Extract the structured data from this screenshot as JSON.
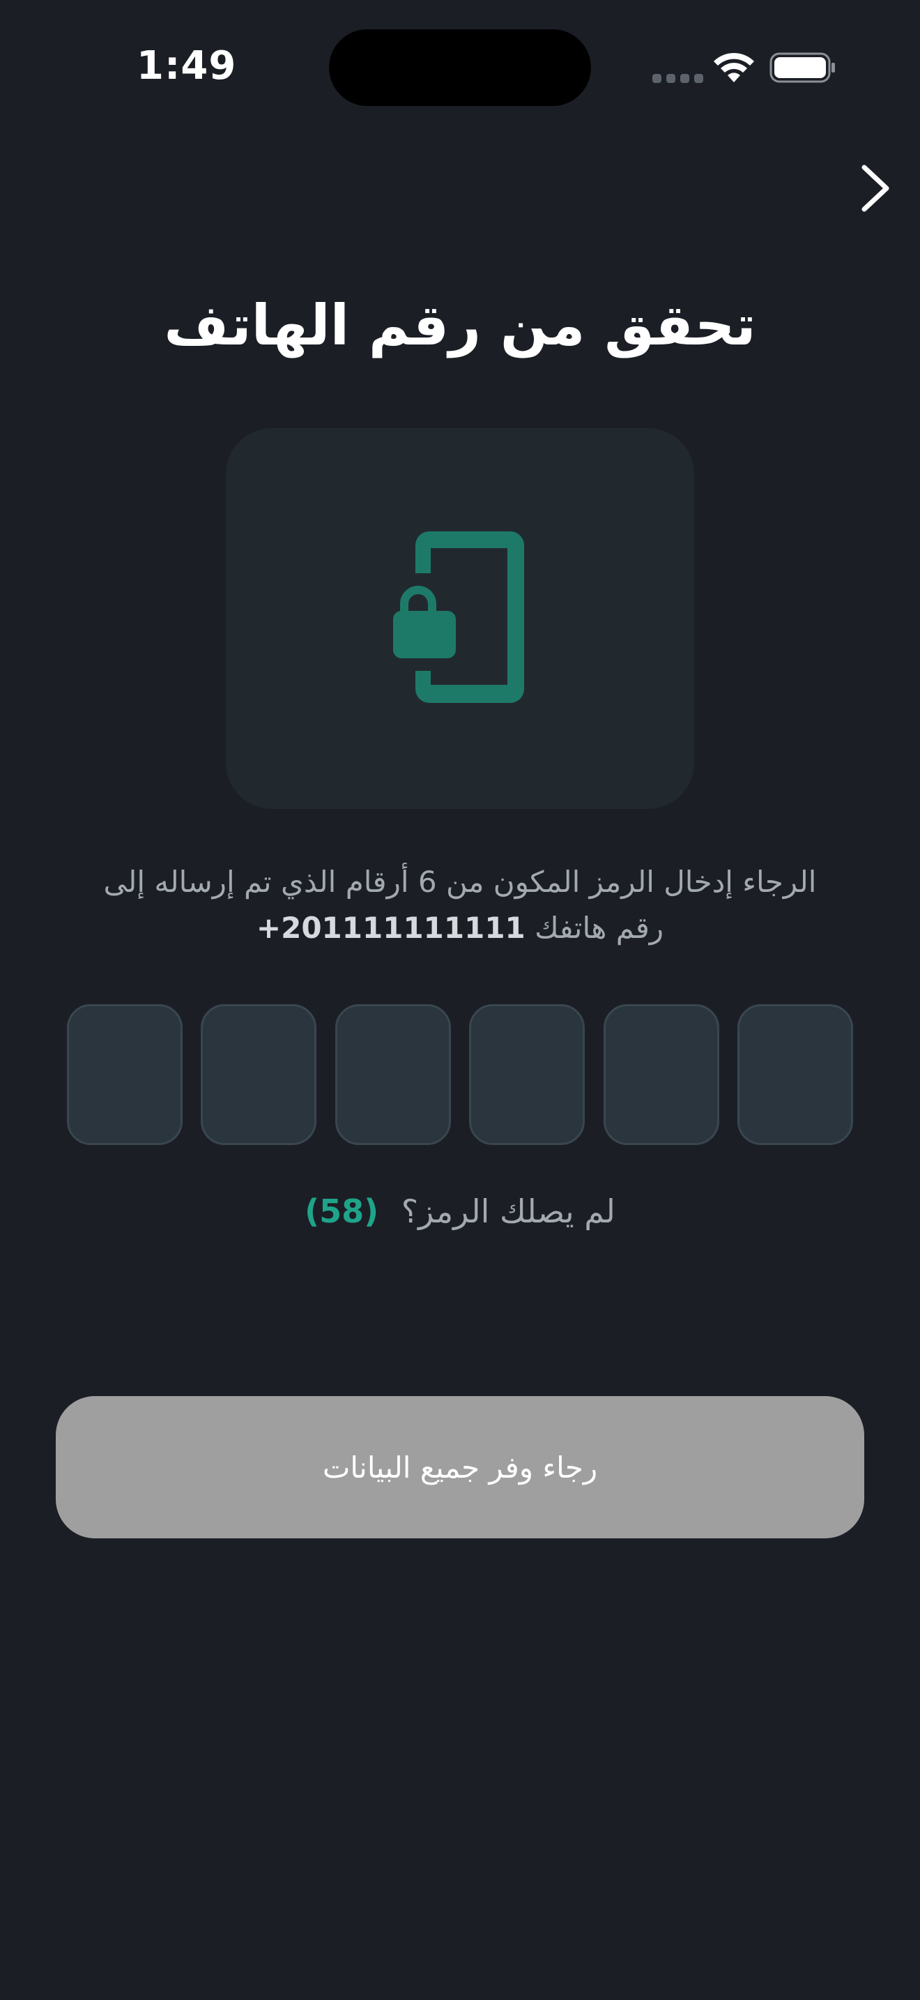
{
  "status_bar": {
    "time": "1:49"
  },
  "header": {
    "back_icon": "chevron-right-icon"
  },
  "title": "تحقق من رقم الهاتف",
  "illustration": {
    "icon": "phone-lock-icon",
    "accent_color": "#1e7a68"
  },
  "instructions": {
    "line1": "الرجاء إدخال الرمز المكون من 6 أرقام الذي تم إرساله إلى",
    "line2_prefix": "رقم هاتفك",
    "phone_number": "+201111111111"
  },
  "otp": {
    "length": 6,
    "digits": [
      "",
      "",
      "",
      "",
      "",
      ""
    ]
  },
  "resend": {
    "label": "لم يصلك الرمز؟",
    "timer": "(58)"
  },
  "submit_button": {
    "label": "رجاء وفر جميع البيانات",
    "enabled": false
  },
  "colors": {
    "background": "#1b1f25",
    "accent": "#1fa48a",
    "button_disabled": "#9f9f9f"
  }
}
